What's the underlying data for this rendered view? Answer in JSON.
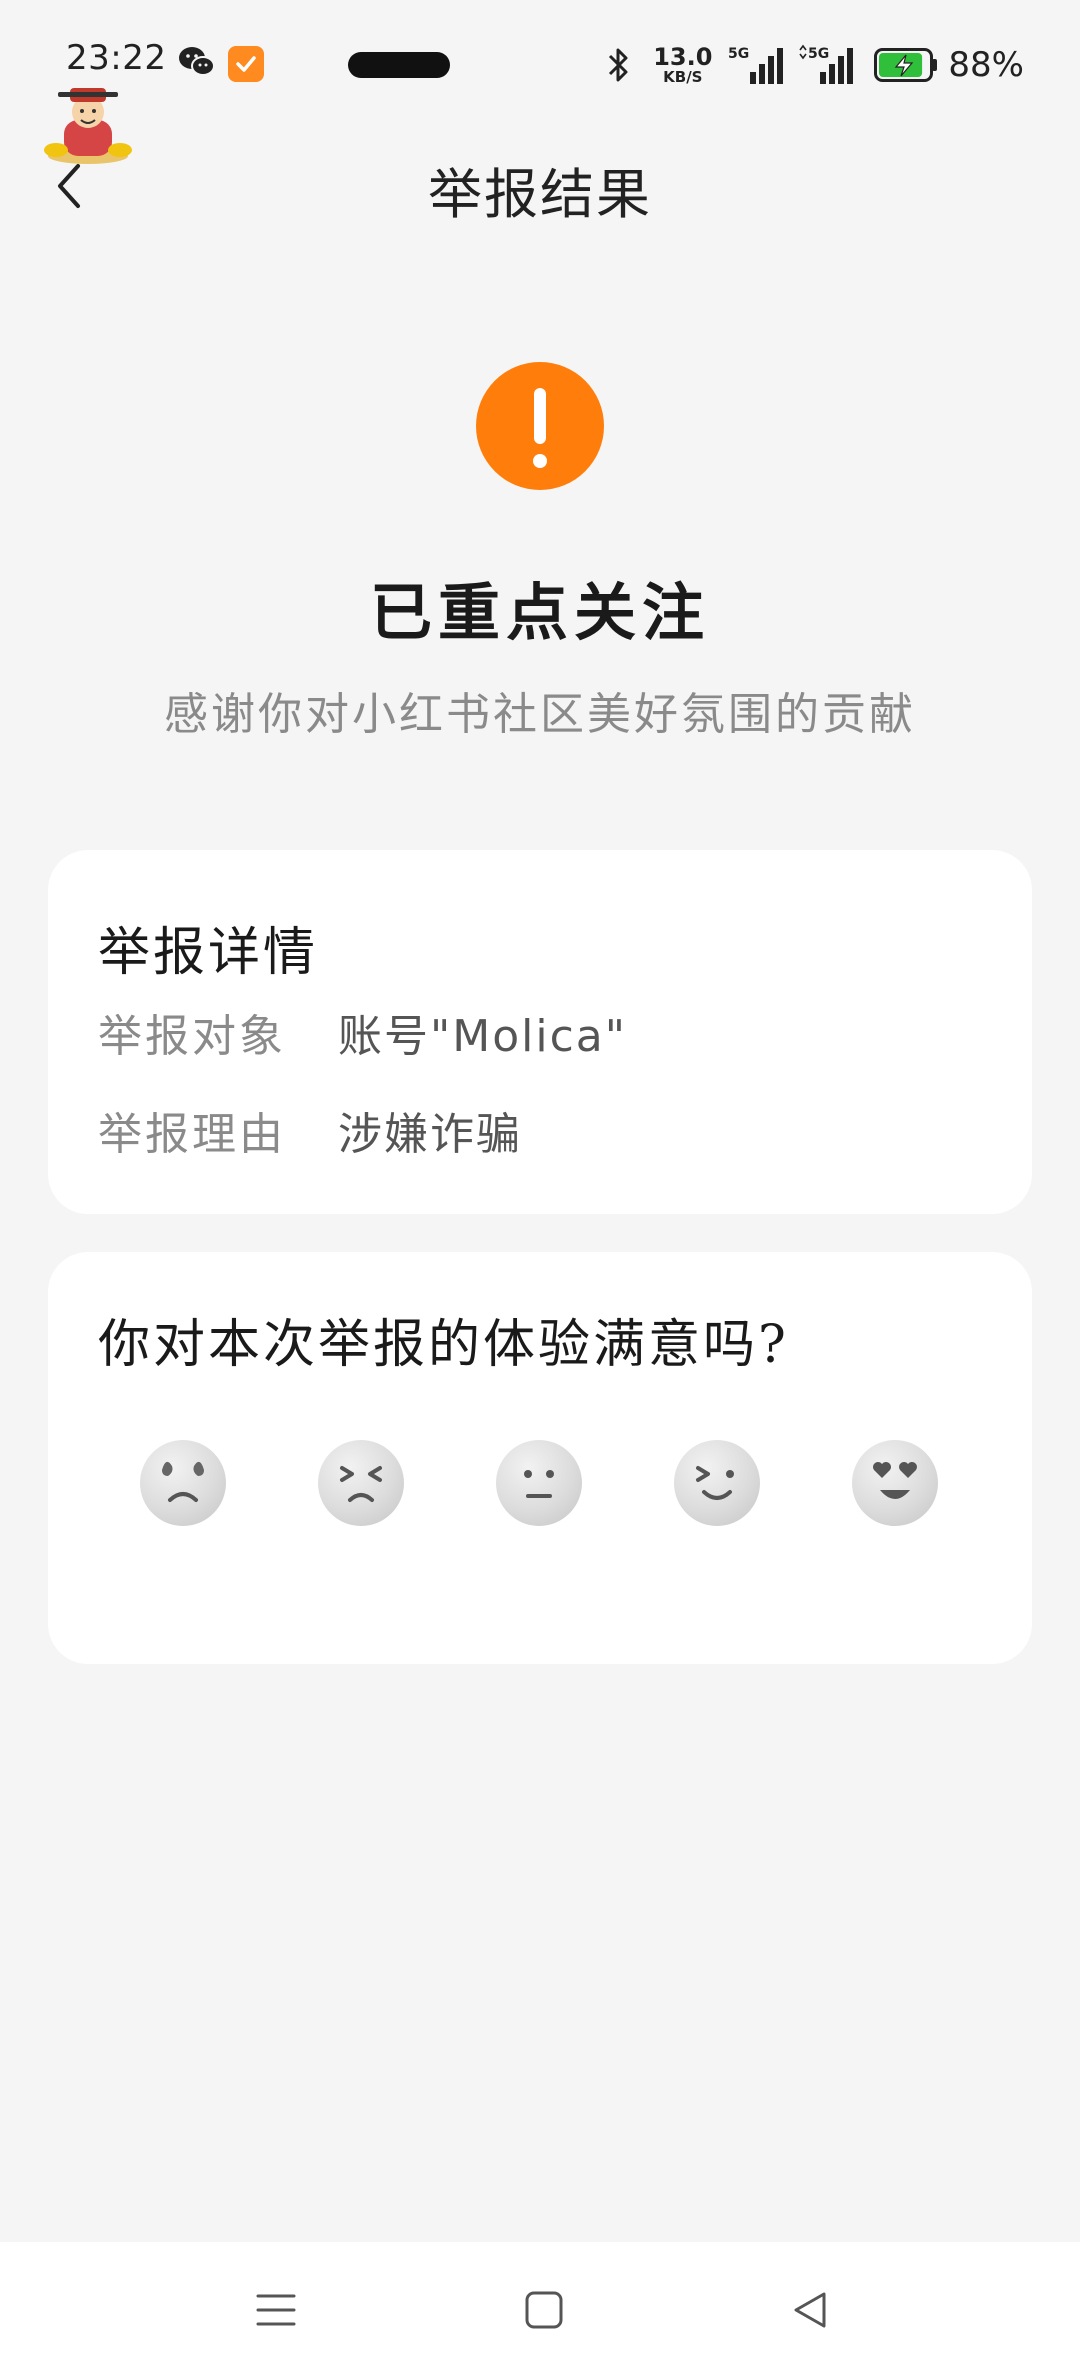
{
  "status_bar": {
    "time": "23:22",
    "net_speed_value": "13.0",
    "net_speed_unit": "KB/S",
    "signal_1_label": "5G",
    "signal_2_label": "5G",
    "battery_percent": "88%",
    "battery_level": 0.88,
    "icons": [
      "wechat-icon",
      "app-notification-icon",
      "bluetooth-icon",
      "signal-icon",
      "battery-charging-icon"
    ]
  },
  "header": {
    "title": "举报结果",
    "back_icon": "chevron-left-icon"
  },
  "result": {
    "icon": "exclamation-circle-icon",
    "accent_color": "#ff7e0b",
    "title": "已重点关注",
    "subtitle": "感谢你对小红书社区美好氛围的贡献"
  },
  "details": {
    "heading": "举报详情",
    "rows": [
      {
        "label": "举报对象",
        "value": "账号\"Molica\""
      },
      {
        "label": "举报理由",
        "value": "涉嫌诈骗"
      }
    ]
  },
  "feedback": {
    "question": "你对本次举报的体验满意吗?",
    "options": [
      "very-dissatisfied-emoji",
      "dissatisfied-emoji",
      "neutral-emoji",
      "satisfied-emoji",
      "very-satisfied-emoji"
    ]
  },
  "nav_bar": {
    "icons": [
      "menu-icon",
      "home-icon",
      "back-icon"
    ]
  }
}
